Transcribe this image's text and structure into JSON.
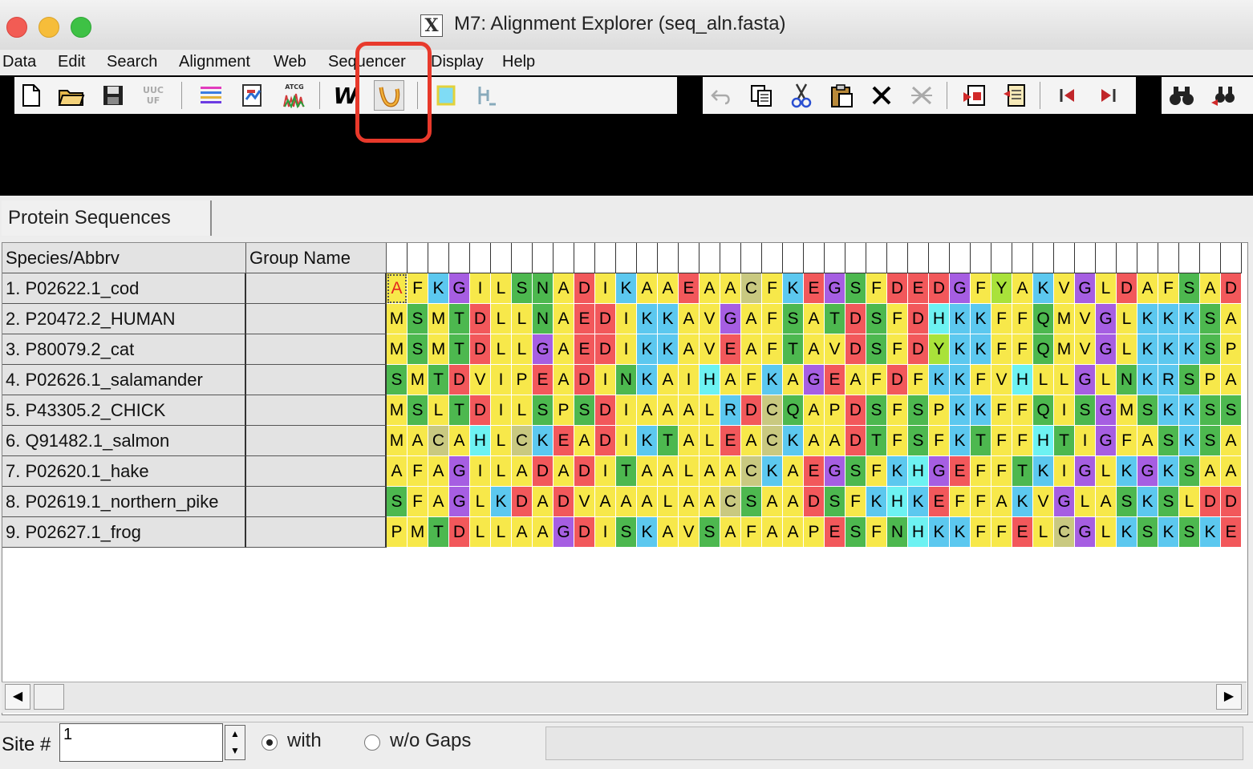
{
  "window": {
    "title": "M7: Alignment Explorer (seq_aln.fasta)",
    "x_icon": "X"
  },
  "menu": [
    "Data",
    "Edit",
    "Search",
    "Alignment",
    "Web",
    "Sequencer",
    "Display",
    "Help"
  ],
  "toolbar": {
    "text_icon_uuc": "UUC",
    "text_icon_uf": "UF",
    "text_icon_atcg": "ATCG",
    "muscle_glyph": "W"
  },
  "tab": {
    "label": "Protein Sequences"
  },
  "grid": {
    "headers": {
      "species": "Species/Abbrv",
      "group": "Group Name"
    },
    "rows": [
      {
        "name": "1. P02622.1_cod",
        "group": "",
        "seq": "AFKGILSNADIKAAEAACFKEGSFDEDGFYAKVGLDAFSAD"
      },
      {
        "name": "2. P20472.2_HUMAN",
        "group": "",
        "seq": "MSMTDLLNAEDIKKAVGAFSATDSFDHKKFFQMVGLKKKSA"
      },
      {
        "name": "3. P80079.2_cat",
        "group": "",
        "seq": "MSMTDLLGAEDIKKAVEAFTAVDSFDYKKFFQMVGLKKKSP"
      },
      {
        "name": "4. P02626.1_salamander",
        "group": "",
        "seq": "SMTDVIPEADINKAIHAFKAGEAFDFKKFVHLLGLNKRSPA"
      },
      {
        "name": "5. P43305.2_CHICK",
        "group": "",
        "seq": "MSLTDILSPSDIAAALRDCQAPDSFSPKKFFQISGMSKKSS"
      },
      {
        "name": "6. Q91482.1_salmon",
        "group": "",
        "seq": "MACAHLCKEADIKTALEACKAADTFSFKTFFHTIGFASKSA"
      },
      {
        "name": "7. P02620.1_hake",
        "group": "",
        "seq": "AFAGILADADITAALAACKAEGSFKHGEFFTKIGLKGKSAA"
      },
      {
        "name": "8. P02619.1_northern_pike",
        "group": "",
        "seq": "SFAGLKDADVAAALAACSAADSFKHKEFFAKVGLASKSLDD"
      },
      {
        "name": "9. P02627.1_frog",
        "group": "",
        "seq": "PMTDLLAAGDISKAVSAFAAPESFNHKKFFELCGLKSKSKE"
      }
    ],
    "selected_cell": {
      "row": 0,
      "col": 0
    },
    "residue_colors": {
      "A": "#f7e84a",
      "V": "#f7e84a",
      "L": "#f7e84a",
      "I": "#f7e84a",
      "M": "#f7e84a",
      "F": "#f7e84a",
      "P": "#f7e84a",
      "K": "#5cc8ef",
      "R": "#5cc8ef",
      "H": "#6df2f2",
      "D": "#f2585b",
      "E": "#f2585b",
      "S": "#4db84f",
      "T": "#4db84f",
      "N": "#4db84f",
      "Q": "#4db84f",
      "G": "#a65ee2",
      "C": "#c9c980",
      "Y": "#a9e23a",
      "W": "#a9e23a"
    }
  },
  "status": {
    "site_label": "Site #",
    "site_value": "1",
    "with_label": "with",
    "without_label": "w/o Gaps",
    "selected": "with"
  }
}
